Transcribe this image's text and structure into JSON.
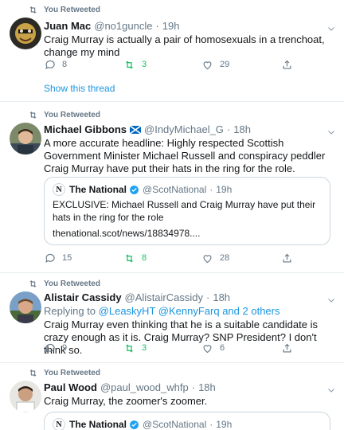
{
  "retweet_label": "You Retweeted",
  "colors": {
    "link": "#1b95e0",
    "retweet_green": "#17bf63",
    "muted": "#657786",
    "border": "#e6ecf0"
  },
  "tweets": [
    {
      "name": "Juan Mac",
      "handle": "@no1guncle",
      "dot": "·",
      "time": "19h",
      "text": "Craig Murray is actually a pair of homosexuals in a trenchoat, change my mind",
      "replies": "8",
      "retweets": "3",
      "likes": "29",
      "show_thread": "Show this thread"
    },
    {
      "name": "Michael Gibbons",
      "handle": "@IndyMichael_G",
      "dot": "·",
      "time": "18h",
      "text": "A more accurate headline: Highly respected Scottish Government Minister Michael Russell and conspiracy peddler Craig Murray have put their hats in the ring for the role.",
      "quote": {
        "logo": "N",
        "name": "The National",
        "handle": "@ScotNational",
        "dot": "·",
        "time": "19h",
        "text": "EXCLUSIVE: Michael Russell and Craig Murray have put their hats in the ring for the role",
        "link": "thenational.scot/news/18834978...."
      },
      "replies": "15",
      "retweets": "8",
      "likes": "28"
    },
    {
      "name": "Alistair Cassidy",
      "handle": "@AlistairCassidy",
      "dot": "·",
      "time": "18h",
      "replying_prefix": "Replying to",
      "replying_1": "@LeaskyHT",
      "replying_2": "@KennyFarq",
      "replying_3": "and 2 others",
      "text": "Craig Murray even thinking that he is a suitable candidate is crazy enough as it is. Craig Murray? SNP President? I don't think so.",
      "replies": "9",
      "retweets": "3",
      "likes": "6"
    },
    {
      "name": "Paul Wood",
      "handle": "@paul_wood_whfp",
      "dot": "·",
      "time": "18h",
      "text": "Craig Murray, the zoomer's zoomer.",
      "quote": {
        "logo": "N",
        "name": "The National",
        "handle": "@ScotNational",
        "dot": "·",
        "time": "19h"
      }
    }
  ]
}
